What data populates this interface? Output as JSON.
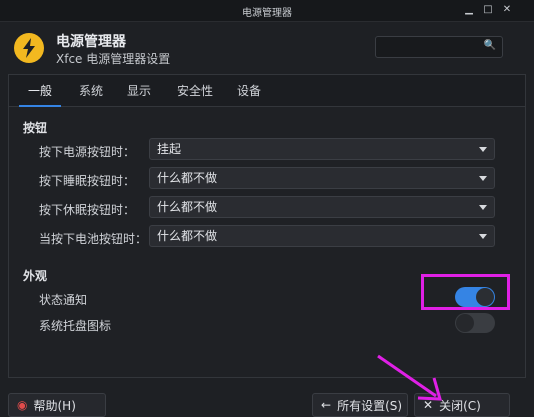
{
  "window": {
    "title": "电源管理器"
  },
  "header": {
    "title": "电源管理器",
    "subtitle": "Xfce 电源管理器设置",
    "search_placeholder": ""
  },
  "tabs": [
    "一般",
    "系统",
    "显示",
    "安全性",
    "设备"
  ],
  "buttons_section": {
    "title": "按钮",
    "rows": [
      {
        "label": "按下电源按钮时：",
        "value": "挂起"
      },
      {
        "label": "按下睡眠按钮时：",
        "value": "什么都不做"
      },
      {
        "label": "按下休眠按钮时：",
        "value": "什么都不做"
      },
      {
        "label": "当按下电池按钮时：",
        "value": "什么都不做"
      }
    ]
  },
  "appearance_section": {
    "title": "外观",
    "status_notify": {
      "label": "状态通知",
      "on": true
    },
    "tray_icon": {
      "label": "系统托盘图标",
      "on": false
    }
  },
  "footer": {
    "help": "帮助(H)",
    "all_settings": "所有设置(S)",
    "close": "关闭(C)"
  },
  "colors": {
    "accent": "#3584e4",
    "highlight": "#e020e6",
    "icon": "#f2b820"
  }
}
